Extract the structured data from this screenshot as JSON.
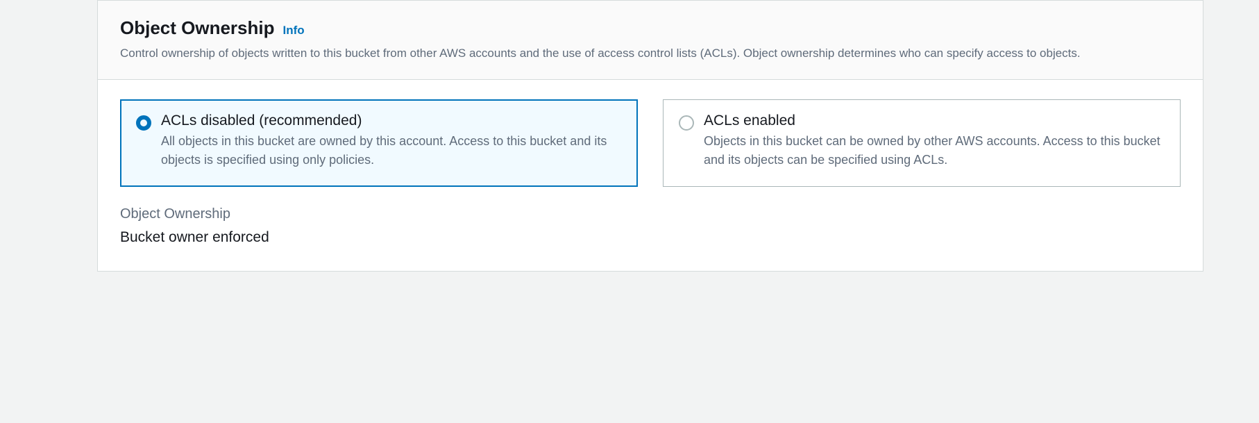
{
  "header": {
    "title": "Object Ownership",
    "info_label": "Info",
    "description": "Control ownership of objects written to this bucket from other AWS accounts and the use of access control lists (ACLs). Object ownership determines who can specify access to objects."
  },
  "options": {
    "disabled": {
      "title": "ACLs disabled (recommended)",
      "description": "All objects in this bucket are owned by this account. Access to this bucket and its objects is specified using only policies."
    },
    "enabled": {
      "title": "ACLs enabled",
      "description": "Objects in this bucket can be owned by other AWS accounts. Access to this bucket and its objects can be specified using ACLs."
    }
  },
  "field": {
    "label": "Object Ownership",
    "value": "Bucket owner enforced"
  }
}
